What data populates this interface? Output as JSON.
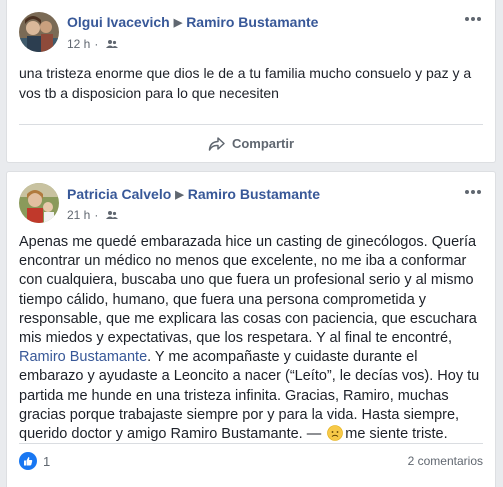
{
  "posts": [
    {
      "author": "Olgui Ivacevich",
      "target": "Ramiro Bustamante",
      "time": "12 h",
      "privacy_icon": "friends-icon",
      "body": "una tristeza enorme que dios le de a tu familia mucho consuelo y paz y a vos tb a disposicion para lo que necesiten",
      "share_label": "Compartir"
    },
    {
      "author": "Patricia Calvelo",
      "target": "Ramiro Bustamante",
      "time": "21 h",
      "privacy_icon": "friends-icon",
      "body_part1": "Apenas me quedé embarazada hice un casting de ginecólogos. Quería encontrar un médico no menos que excelente, no me iba a conformar con cualquiera, buscaba uno que fuera un profesional serio y al mismo tiempo cálido, humano, que fuera una persona comprometida y responsable, que me explicara las cosas con paciencia, que escuchara mis miedos y expectativas, que los respetara. Y al final te encontré, ",
      "mention": "Ramiro Bustamante",
      "body_part2": ". Y me acompañaste y cuidaste durante el embarazo y ayudaste a Leoncito a nacer (“Leíto”, le decías vos). Hoy tu partida me hunde en una tristeza infinita. Gracias, Ramiro, muchas gracias porque trabajaste siempre por y para la vida. Hasta siempre, querido doctor y amigo Ramiro Bustamante. —",
      "feeling": "me siente triste.",
      "reaction_count": "1",
      "comments_label": "2 comentarios"
    }
  ],
  "colors": {
    "link": "#385898",
    "like": "#1877f2",
    "meta": "#606770",
    "background": "#e9ebee"
  }
}
